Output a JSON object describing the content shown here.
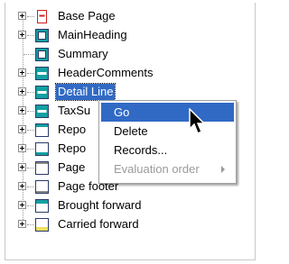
{
  "tree": {
    "items": [
      {
        "label": "Base Page",
        "icon": "base-page-icon"
      },
      {
        "label": "MainHeading",
        "icon": "section-icon"
      },
      {
        "label": "Summary",
        "icon": "section-icon"
      },
      {
        "label": "HeaderComments",
        "icon": "band-icon"
      },
      {
        "label": "Detail Line",
        "icon": "band-icon"
      },
      {
        "label": "TaxSu",
        "icon": "band-icon"
      },
      {
        "label": "Repo",
        "icon": "band-icon"
      },
      {
        "label": "Repo",
        "icon": "band-icon"
      },
      {
        "label": "Page",
        "icon": "band-icon"
      },
      {
        "label": "Page footer",
        "icon": "band-icon"
      },
      {
        "label": "Brought forward",
        "icon": "band-icon"
      },
      {
        "label": "Carried forward",
        "icon": "band-icon"
      }
    ]
  },
  "context_menu": {
    "items": [
      {
        "label": "Go"
      },
      {
        "label": "Delete"
      },
      {
        "label": "Records..."
      },
      {
        "label": "Evaluation order"
      }
    ]
  },
  "colors": {
    "selection": "#316ac5",
    "icon_teal": "#14a0a0",
    "icon_red": "#d02020",
    "icon_yellow": "#f0e060"
  }
}
